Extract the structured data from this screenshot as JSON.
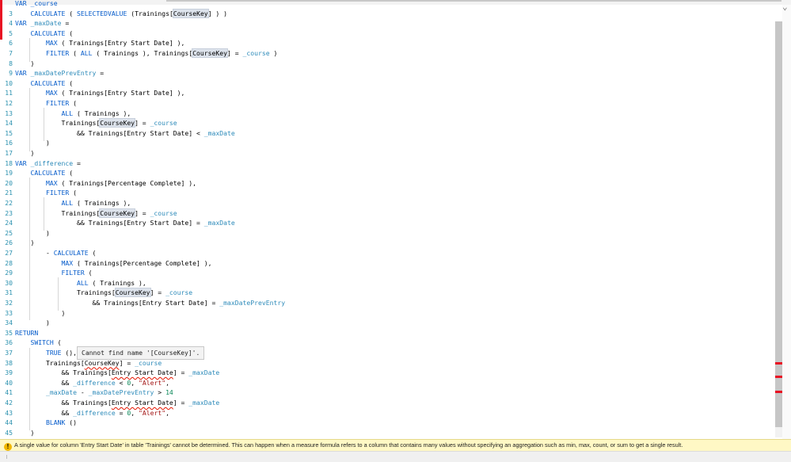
{
  "editor": {
    "lines": [
      {
        "n": "",
        "t": [
          [
            "kw",
            "VAR _course"
          ]
        ]
      },
      {
        "n": "3",
        "t": [
          [
            "",
            "    "
          ],
          [
            "kw",
            "CALCULATE"
          ],
          [
            "",
            " ( "
          ],
          [
            "kw",
            "SELECTEDVALUE"
          ],
          [
            "",
            " (Trainings["
          ],
          [
            "hl",
            "CourseKey"
          ],
          [
            "",
            "] ) )"
          ]
        ]
      },
      {
        "n": "4",
        "t": [
          [
            "kw",
            "VAR"
          ],
          [
            "",
            " "
          ],
          [
            "var",
            "_maxDate"
          ],
          [
            "",
            " ="
          ]
        ]
      },
      {
        "n": "5",
        "t": [
          [
            "",
            "    "
          ],
          [
            "kw",
            "CALCULATE"
          ],
          [
            "",
            " ("
          ]
        ]
      },
      {
        "n": "6",
        "t": [
          [
            "",
            "        "
          ],
          [
            "kw",
            "MAX"
          ],
          [
            "",
            " ( Trainings[Entry Start Date] ),"
          ]
        ]
      },
      {
        "n": "7",
        "t": [
          [
            "",
            "        "
          ],
          [
            "kw",
            "FILTER"
          ],
          [
            "",
            " ( "
          ],
          [
            "kw",
            "ALL"
          ],
          [
            "",
            " ( Trainings ), Trainings["
          ],
          [
            "hl",
            "CourseKey"
          ],
          [
            "",
            "] = "
          ],
          [
            "var",
            "_course"
          ],
          [
            "",
            " )"
          ]
        ]
      },
      {
        "n": "8",
        "t": [
          [
            "",
            "    )"
          ]
        ]
      },
      {
        "n": "9",
        "t": [
          [
            "kw",
            "VAR"
          ],
          [
            "",
            " "
          ],
          [
            "var",
            "_maxDatePrevEntry"
          ],
          [
            "",
            " ="
          ]
        ]
      },
      {
        "n": "10",
        "t": [
          [
            "",
            "    "
          ],
          [
            "kw",
            "CALCULATE"
          ],
          [
            "",
            " ("
          ]
        ]
      },
      {
        "n": "11",
        "t": [
          [
            "",
            "        "
          ],
          [
            "kw",
            "MAX"
          ],
          [
            "",
            " ( Trainings[Entry Start Date] ),"
          ]
        ]
      },
      {
        "n": "12",
        "t": [
          [
            "",
            "        "
          ],
          [
            "kw",
            "FILTER"
          ],
          [
            "",
            " ("
          ]
        ]
      },
      {
        "n": "13",
        "t": [
          [
            "",
            "            "
          ],
          [
            "kw",
            "ALL"
          ],
          [
            "",
            " ( Trainings ),"
          ]
        ]
      },
      {
        "n": "14",
        "t": [
          [
            "",
            "            Trainings["
          ],
          [
            "hl",
            "CourseKey"
          ],
          [
            "",
            "] = "
          ],
          [
            "var",
            "_course"
          ]
        ]
      },
      {
        "n": "15",
        "t": [
          [
            "",
            "                && Trainings[Entry Start Date] < "
          ],
          [
            "var",
            "_maxDate"
          ]
        ]
      },
      {
        "n": "16",
        "t": [
          [
            "",
            "        )"
          ]
        ]
      },
      {
        "n": "17",
        "t": [
          [
            "",
            "    )"
          ]
        ]
      },
      {
        "n": "18",
        "t": [
          [
            "kw",
            "VAR"
          ],
          [
            "",
            " "
          ],
          [
            "var",
            "_difference"
          ],
          [
            "",
            " ="
          ]
        ]
      },
      {
        "n": "19",
        "t": [
          [
            "",
            "    "
          ],
          [
            "kw",
            "CALCULATE"
          ],
          [
            "",
            " ("
          ]
        ]
      },
      {
        "n": "20",
        "t": [
          [
            "",
            "        "
          ],
          [
            "kw",
            "MAX"
          ],
          [
            "",
            " ( Trainings[Percentage Complete] ),"
          ]
        ]
      },
      {
        "n": "21",
        "t": [
          [
            "",
            "        "
          ],
          [
            "kw",
            "FILTER"
          ],
          [
            "",
            " ("
          ]
        ]
      },
      {
        "n": "22",
        "t": [
          [
            "",
            "            "
          ],
          [
            "kw",
            "ALL"
          ],
          [
            "",
            " ( Trainings ),"
          ]
        ]
      },
      {
        "n": "23",
        "t": [
          [
            "",
            "            Trainings["
          ],
          [
            "hl",
            "CourseKey"
          ],
          [
            "",
            "] = "
          ],
          [
            "var",
            "_course"
          ]
        ]
      },
      {
        "n": "24",
        "t": [
          [
            "",
            "                && Trainings[Entry Start Date] = "
          ],
          [
            "var",
            "_maxDate"
          ]
        ]
      },
      {
        "n": "25",
        "t": [
          [
            "",
            "        )"
          ]
        ]
      },
      {
        "n": "26",
        "t": [
          [
            "",
            "    )"
          ]
        ]
      },
      {
        "n": "27",
        "t": [
          [
            "",
            "        - "
          ],
          [
            "kw",
            "CALCULATE"
          ],
          [
            "",
            " ("
          ]
        ]
      },
      {
        "n": "28",
        "t": [
          [
            "",
            "            "
          ],
          [
            "kw",
            "MAX"
          ],
          [
            "",
            " ( Trainings[Percentage Complete] ),"
          ]
        ]
      },
      {
        "n": "29",
        "t": [
          [
            "",
            "            "
          ],
          [
            "kw",
            "FILTER"
          ],
          [
            "",
            " ("
          ]
        ]
      },
      {
        "n": "30",
        "t": [
          [
            "",
            "                "
          ],
          [
            "kw",
            "ALL"
          ],
          [
            "",
            " ( Trainings ),"
          ]
        ]
      },
      {
        "n": "31",
        "t": [
          [
            "",
            "                Trainings["
          ],
          [
            "hl",
            "CourseKey"
          ],
          [
            "",
            "] = "
          ],
          [
            "var",
            "_course"
          ]
        ]
      },
      {
        "n": "32",
        "t": [
          [
            "",
            "                    && Trainings[Entry Start Date] = "
          ],
          [
            "var",
            "_maxDatePrevEntry"
          ]
        ]
      },
      {
        "n": "33",
        "t": [
          [
            "",
            "            )"
          ]
        ]
      },
      {
        "n": "34",
        "t": [
          [
            "",
            "        )"
          ]
        ]
      },
      {
        "n": "35",
        "t": [
          [
            "kw",
            "RETURN"
          ]
        ]
      },
      {
        "n": "36",
        "t": [
          [
            "",
            "    "
          ],
          [
            "kw",
            "SWITCH"
          ],
          [
            "",
            " ("
          ]
        ]
      },
      {
        "n": "37",
        "t": [
          [
            "",
            "        "
          ],
          [
            "kw",
            "TRUE"
          ],
          [
            "",
            " (),"
          ]
        ]
      },
      {
        "n": "38",
        "t": [
          [
            "",
            "        Trainings["
          ],
          [
            "sq",
            "CourseKey"
          ],
          [
            "",
            "] = "
          ],
          [
            "var",
            "_course"
          ]
        ]
      },
      {
        "n": "39",
        "t": [
          [
            "",
            "            && Trainings["
          ],
          [
            "sq",
            "Entry Start Date"
          ],
          [
            "",
            "] = "
          ],
          [
            "var",
            "_maxDate"
          ]
        ]
      },
      {
        "n": "40",
        "t": [
          [
            "",
            "            && "
          ],
          [
            "var",
            "_difference"
          ],
          [
            "",
            " < "
          ],
          [
            "num",
            "0"
          ],
          [
            "",
            ", "
          ],
          [
            "str",
            "\"Alert\""
          ],
          [
            "",
            ","
          ]
        ]
      },
      {
        "n": "41",
        "t": [
          [
            "",
            "        "
          ],
          [
            "var",
            "_maxDate"
          ],
          [
            "",
            " - "
          ],
          [
            "var",
            "_maxDatePrevEntry"
          ],
          [
            "",
            " > "
          ],
          [
            "num",
            "14"
          ]
        ]
      },
      {
        "n": "42",
        "t": [
          [
            "",
            "            && Trainings["
          ],
          [
            "sq",
            "Entry Start Date"
          ],
          [
            "",
            "] = "
          ],
          [
            "var",
            "_maxDate"
          ]
        ]
      },
      {
        "n": "43",
        "t": [
          [
            "",
            "            && "
          ],
          [
            "var",
            "_difference"
          ],
          [
            "",
            " = "
          ],
          [
            "num",
            "0"
          ],
          [
            "",
            ", "
          ],
          [
            "str",
            "\"Alert\""
          ],
          [
            "",
            ","
          ]
        ]
      },
      {
        "n": "44",
        "t": [
          [
            "",
            "        "
          ],
          [
            "kw",
            "BLANK"
          ],
          [
            "",
            " ()"
          ]
        ]
      },
      {
        "n": "45",
        "t": [
          [
            "",
            "    )"
          ]
        ]
      }
    ]
  },
  "tooltip": {
    "text": "Cannot find name '[CourseKey]'."
  },
  "status": {
    "message": "A single value for column 'Entry Start Date' in table 'Trainings' cannot be determined. This can happen when a measure formula refers to a column that contains many values without specifying an aggregation such as min, max, count, or sum to get a single result."
  },
  "icons": {
    "warning": "warning-icon",
    "chevron": "chevron-down-icon"
  },
  "colors": {
    "keyword": "#035aca",
    "variable": "#2e8bba",
    "string": "#a31515",
    "number": "#098658",
    "warning_bar": "#fff8c5",
    "error_marker": "#e81123"
  }
}
